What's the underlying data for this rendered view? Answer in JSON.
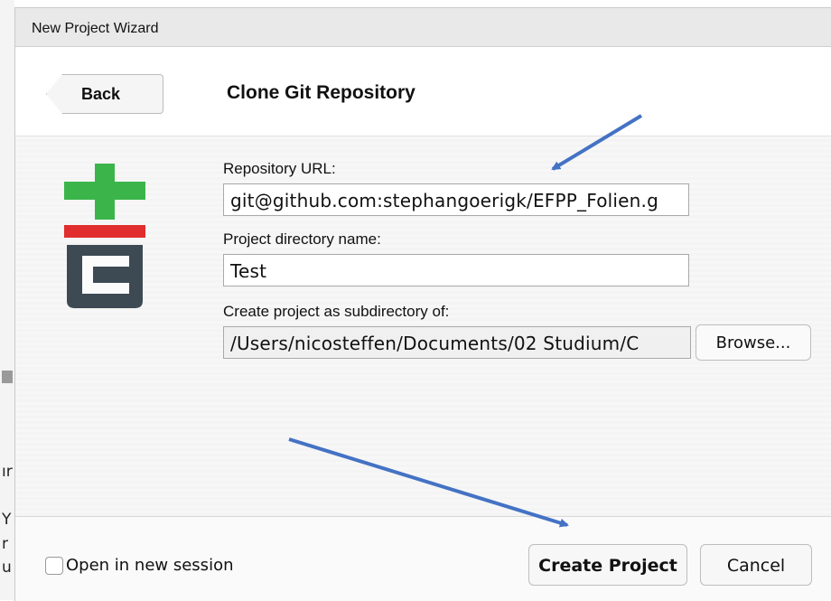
{
  "window": {
    "title": "New Project Wizard"
  },
  "header": {
    "back_label": "Back",
    "heading": "Clone Git Repository"
  },
  "form": {
    "repo_url_label": "Repository URL:",
    "repo_url_value": "git@github.com:stephangoerigk/EFPP_Folien.g",
    "dir_name_label": "Project directory name:",
    "dir_name_value": "Test",
    "subdir_label": "Create project as subdirectory of:",
    "subdir_value": "/Users/nicosteffen/Documents/02 Studium/C",
    "browse_label": "Browse..."
  },
  "footer": {
    "new_session_label": "Open in new session",
    "new_session_checked": false,
    "create_label": "Create Project",
    "cancel_label": "Cancel"
  },
  "behind_text": [
    "ır",
    "Y",
    "r",
    "u"
  ],
  "colors": {
    "arrow": "#4472c4",
    "git_green": "#3bb54a",
    "git_red": "#e12d2d",
    "git_gray": "#3d4a54"
  }
}
